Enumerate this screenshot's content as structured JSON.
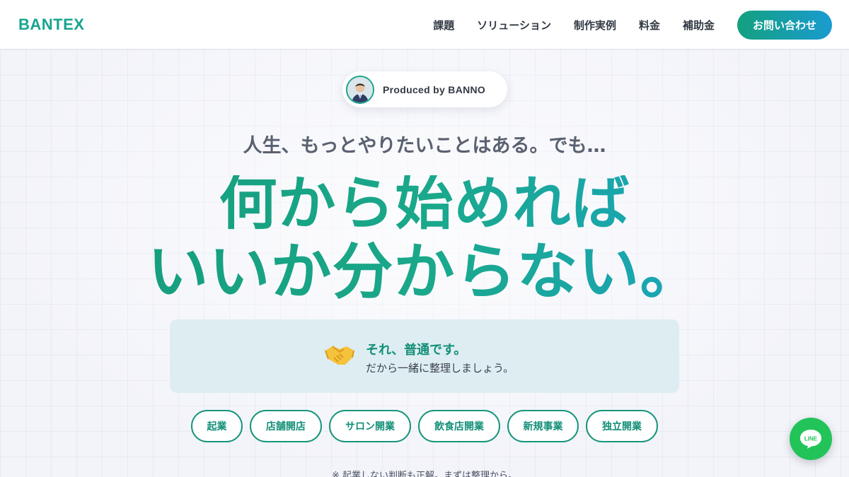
{
  "header": {
    "logo": "BANTEX",
    "nav": [
      "課題",
      "ソリューション",
      "制作実例",
      "料金",
      "補助金"
    ],
    "cta_label": "お問い合わせ"
  },
  "hero": {
    "badge_text": "Produced by BANNO",
    "lead": "人生、もっとやりたいことはある。でも…",
    "headline_line1": "何から始めれば",
    "headline_line2": "いいか分からない。",
    "info_title": "それ、普通です。",
    "info_sub": "だから一緒に整理しましょう。",
    "tags": [
      "起業",
      "店舗開店",
      "サロン開業",
      "飲食店開業",
      "新規事業",
      "独立開業"
    ],
    "note": "※ 起業しない判断も正解。まずは整理から。"
  },
  "line_button": {
    "label": "LINE"
  },
  "colors": {
    "brand_green": "#17a48f",
    "accent_blue": "#1ba4d2",
    "line_green": "#22c45a"
  },
  "icons": [
    "handshake-icon",
    "line-icon",
    "avatar"
  ]
}
